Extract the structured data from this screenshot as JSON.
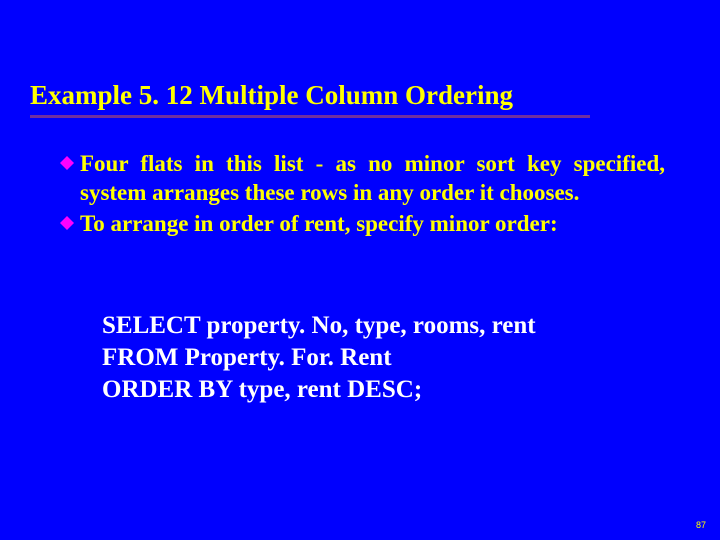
{
  "title": "Example 5. 12  Multiple Column Ordering",
  "bullets": [
    "Four flats in this list - as no minor sort key specified, system arranges these rows in any order it chooses.",
    "To arrange in order of rent, specify minor order:"
  ],
  "code": [
    "SELECT property. No, type, rooms, rent",
    "FROM Property. For. Rent",
    "ORDER BY type, rent DESC;"
  ],
  "pageNumber": "87",
  "colors": {
    "background": "#0000fe",
    "accent": "#ffff00",
    "bulletIcon": "#ff00ff",
    "underline": "#7030a0",
    "code": "#ffffff"
  }
}
